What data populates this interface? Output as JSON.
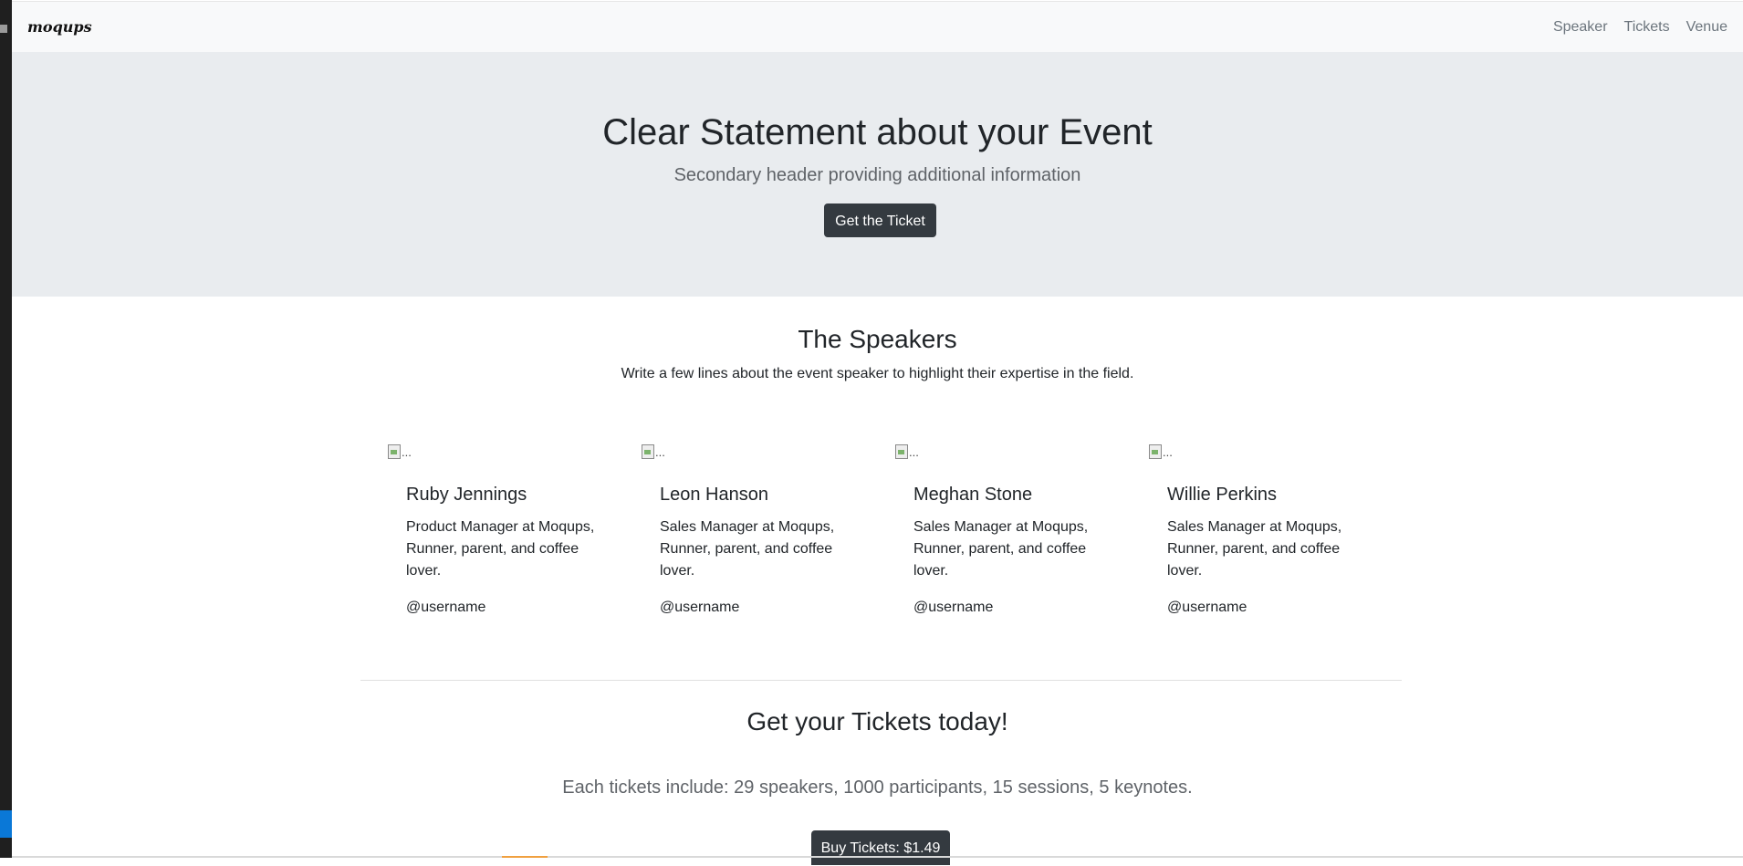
{
  "navbar": {
    "brand": "moqups",
    "links": [
      "Speaker",
      "Tickets",
      "Venue"
    ]
  },
  "hero": {
    "title": "Clear Statement about your Event",
    "subtitle": "Secondary header providing additional information",
    "button_label": "Get the Ticket"
  },
  "speakers": {
    "title": "The Speakers",
    "subtitle": "Write a few lines about the event speaker to highlight their expertise in the field.",
    "cards": [
      {
        "image_alt": "...",
        "name": "Ruby Jennings",
        "description": "Product Manager at Moqups, Runner, parent, and coffee lover.",
        "username": "@username"
      },
      {
        "image_alt": "...",
        "name": "Leon Hanson",
        "description": "Sales Manager at Moqups, Runner, parent, and coffee lover.",
        "username": "@username"
      },
      {
        "image_alt": "...",
        "name": "Meghan Stone",
        "description": "Sales Manager at Moqups, Runner, parent, and coffee lover.",
        "username": "@username"
      },
      {
        "image_alt": "...",
        "name": "Willie Perkins",
        "description": "Sales Manager at Moqups, Runner, parent, and coffee lover.",
        "username": "@username"
      }
    ]
  },
  "tickets": {
    "title": "Get your Tickets today!",
    "subtitle": "Each tickets include: 29 speakers, 1000 participants, 15 sessions, 5 keynotes.",
    "button_label": "Buy Tickets: $1.49"
  },
  "colors": {
    "hero_bg": "#e9ecef",
    "navbar_bg": "#f8f9fa",
    "button_dark": "#343a40"
  }
}
